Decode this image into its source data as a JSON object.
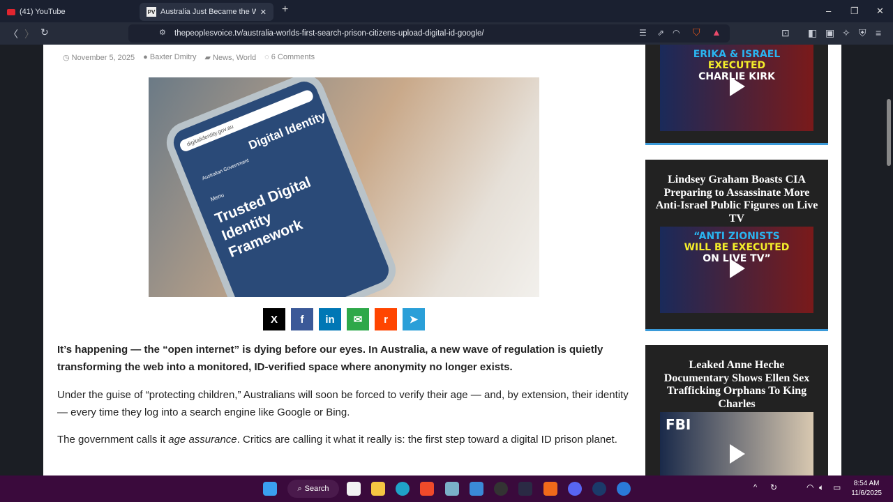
{
  "tabs": [
    {
      "label": "(41) YouTube"
    },
    {
      "label": "Australia Just Became the World"
    }
  ],
  "url": "thepeoplesvoice.tv/australia-worlds-first-search-prison-citizens-upload-digital-id-google/",
  "meta": {
    "date": "November 5, 2025",
    "author": "Baxter Dmitry",
    "categories": "News, World",
    "comments": "6 Comments"
  },
  "hero_text": {
    "site": "digitalidentity.gov.au",
    "title": "Digital Identity",
    "gov": "Australian Government",
    "menu": "Menu",
    "body": "Trusted Digital Identity Framework"
  },
  "share": [
    "X",
    "f",
    "in",
    "✉",
    "r",
    "➤"
  ],
  "article": {
    "lead": "It’s happening — the “open internet” is dying before our eyes. In Australia, a new wave of regulation is quietly transforming the web into a monitored, ID-verified space where anonymity no longer exists.",
    "p1": "Under the guise of “protecting children,” Australians will soon be forced to verify their age — and, by extension, their identity — every time they log into a search engine like Google or Bing.",
    "p2_a": "The government calls it ",
    "p2_em": "age assurance",
    "p2_b": ". Critics are calling it what it really is: the first step toward a digital ID prison planet."
  },
  "sidebar": [
    {
      "title": "",
      "thumb_lines": [
        "ERIKA & ISRAEL",
        "EXECUTED",
        "CHARLIE KIRK"
      ]
    },
    {
      "title": "Lindsey Graham Boasts CIA Preparing to Assassinate More Anti-Israel Public Figures on Live TV",
      "thumb_lines": [
        "“ANTI ZIONISTS",
        "WILL BE EXECUTED",
        "ON LIVE TV”"
      ]
    },
    {
      "title": "Leaked Anne Heche Documentary Shows Ellen Sex Trafficking Orphans To King Charles",
      "thumb_lines": [
        "FBI",
        "",
        ""
      ]
    }
  ],
  "taskbar": {
    "search": "Search",
    "time": "8:54 AM",
    "date": "11/6/2025"
  }
}
